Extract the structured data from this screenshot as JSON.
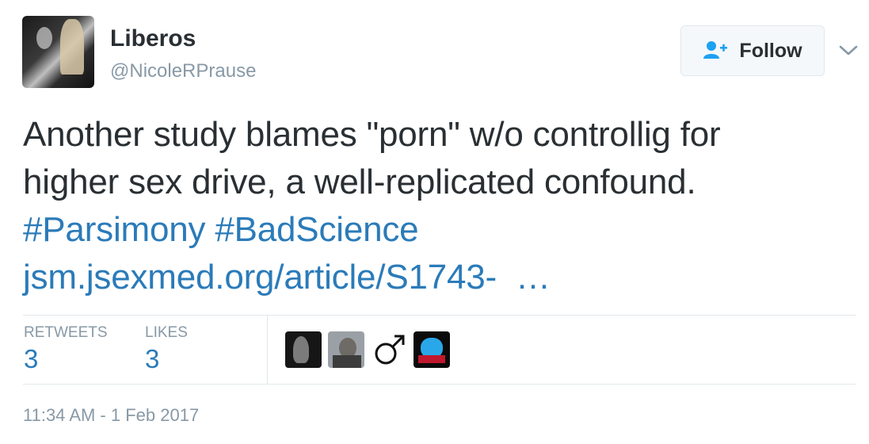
{
  "user": {
    "name": "Liberos",
    "handle": "@NicoleRPrause"
  },
  "follow_button": {
    "label": "Follow"
  },
  "tweet": {
    "line1": "Another study blames \"porn\" w/o controllig for",
    "line2": "higher sex drive, a well-replicated confound.",
    "hashtag1": "#Parsimony",
    "hashtag2": "#BadScience",
    "link": "jsm.jsexmed.org/article/S1743-  …"
  },
  "stats": {
    "retweets_label": "RETWEETS",
    "retweets_value": "3",
    "likes_label": "LIKES",
    "likes_value": "3"
  },
  "likers": {
    "liker3_symbol": "♂"
  },
  "timestamp": "11:34 AM - 1 Feb 2017",
  "colors": {
    "link": "#2b7bb9",
    "text": "#292f33",
    "muted": "#8899a6",
    "follow_icon": "#1da1f2"
  }
}
